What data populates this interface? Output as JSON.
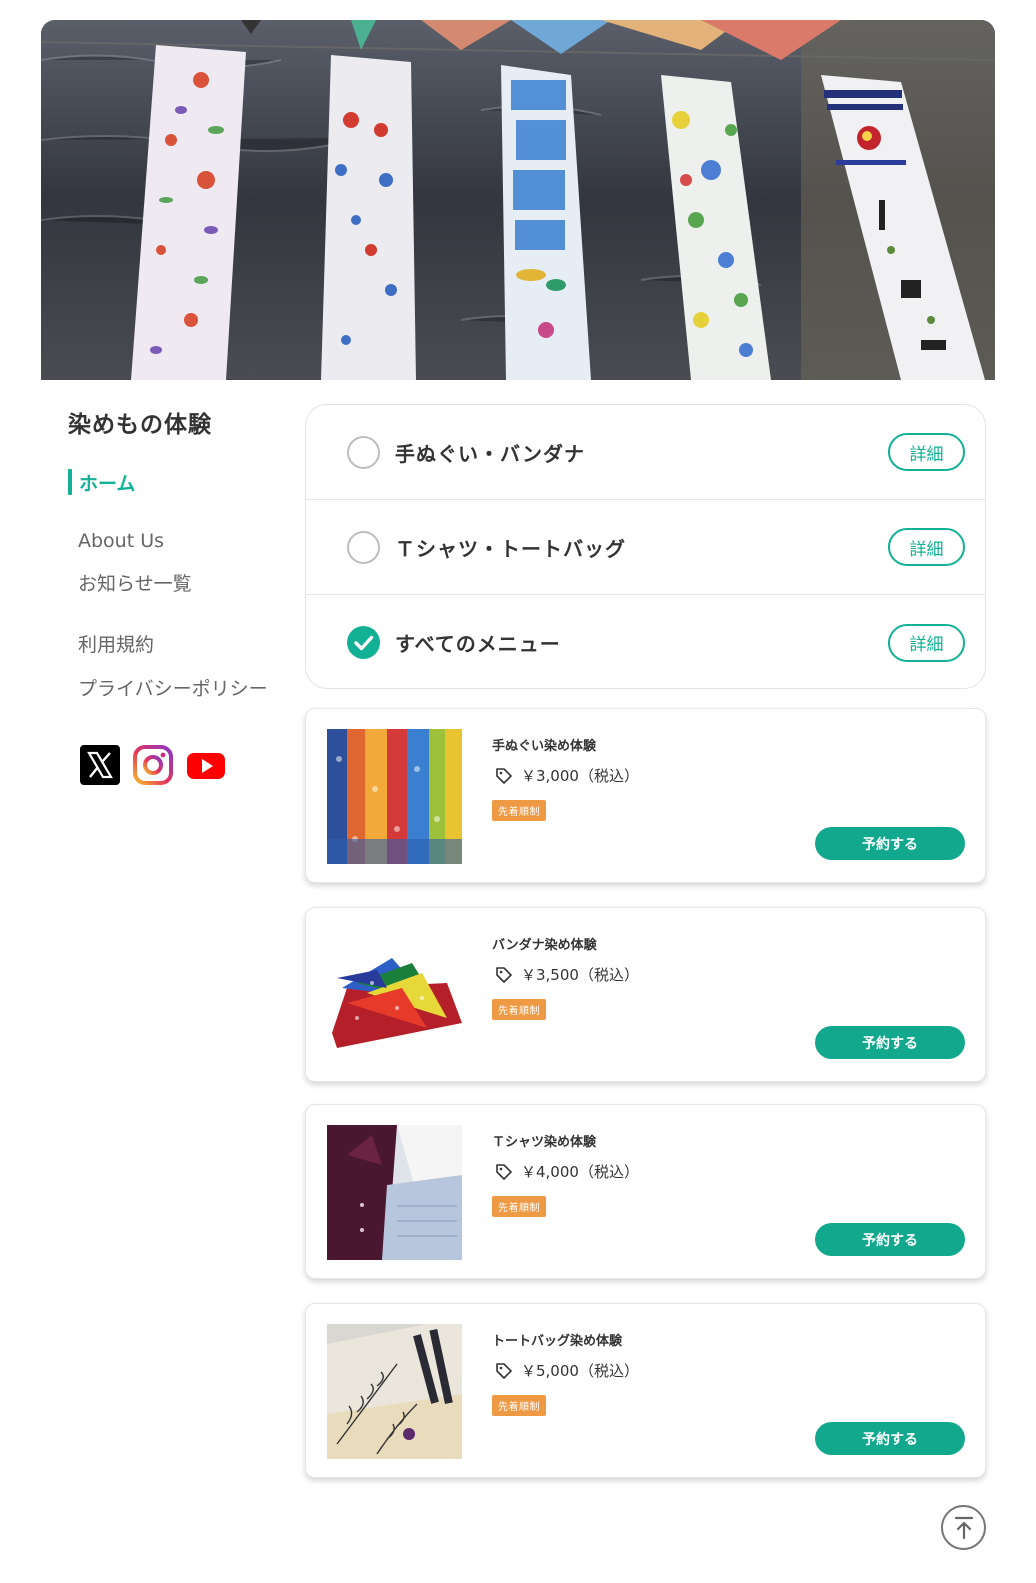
{
  "hero": {
    "image": "dyed-banners-over-river"
  },
  "sidebar": {
    "title": "染めもの体験",
    "active_item": "ホーム",
    "links": [
      "About Us",
      "お知らせ一覧",
      "利用規約",
      "プライバシーポリシー"
    ],
    "social_icons": [
      "x-icon",
      "instagram-icon",
      "youtube-icon"
    ]
  },
  "filters": [
    {
      "label": "手ぬぐい・バンダナ",
      "checked": false,
      "detail": "詳細"
    },
    {
      "label": "Ｔシャツ・トートバッグ",
      "checked": false,
      "detail": "詳細"
    },
    {
      "label": "すべてのメニュー",
      "checked": true,
      "detail": "詳細"
    }
  ],
  "products": [
    {
      "name": "手ぬぐい染め体験",
      "price": "￥3,000（税込）",
      "badge": "先着順制",
      "button": "予約する"
    },
    {
      "name": "バンダナ染め体験",
      "price": "￥3,500（税込）",
      "badge": "先着順制",
      "button": "予約する"
    },
    {
      "name": "Ｔシャツ染め体験",
      "price": "￥4,000（税込）",
      "badge": "先着順制",
      "button": "予約する"
    },
    {
      "name": "トートバッグ染め体験",
      "price": "￥5,000（税込）",
      "badge": "先着順制",
      "button": "予約する"
    }
  ],
  "colors": {
    "accent": "#12b196",
    "button": "#12a88d",
    "badge": "#ee9a45"
  }
}
